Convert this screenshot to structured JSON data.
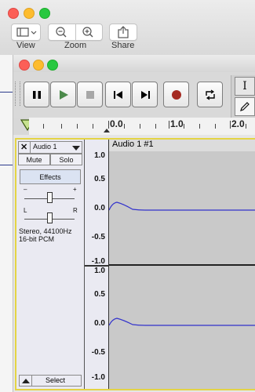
{
  "outer_toolbar": {
    "view_label": "View",
    "zoom_label": "Zoom",
    "share_label": "Share"
  },
  "transport": {
    "pause_icon": "pause-icon",
    "play_icon": "play-icon",
    "stop_icon": "stop-icon",
    "skip_start_icon": "skip-to-start-icon",
    "skip_end_icon": "skip-to-end-icon",
    "record_icon": "record-icon",
    "loop_icon": "loop-icon"
  },
  "tools": {
    "selection": "I",
    "draw": "pencil-icon"
  },
  "ruler": {
    "labels": [
      "0.0",
      "1.0",
      "2.0"
    ]
  },
  "track": {
    "name": "Audio 1",
    "clip_name": "Audio 1 #1",
    "mute_label": "Mute",
    "solo_label": "Solo",
    "effects_label": "Effects",
    "gain_minus": "–",
    "gain_plus": "+",
    "pan_left": "L",
    "pan_right": "R",
    "info_line1": "Stereo, 44100Hz",
    "info_line2": "16-bit PCM",
    "select_label": "Select",
    "scale_top": [
      "1.0",
      "0.5",
      "0.0",
      "-0.5",
      "-1.0"
    ],
    "scale_bottom": [
      "1.0",
      "0.5",
      "0.0",
      "-0.5",
      "-1.0"
    ]
  },
  "colors": {
    "record_red": "#a52a22",
    "play_green": "#4c8a4b",
    "waveform_blue": "#3333cc",
    "track_border_yellow": "#e4d445"
  }
}
